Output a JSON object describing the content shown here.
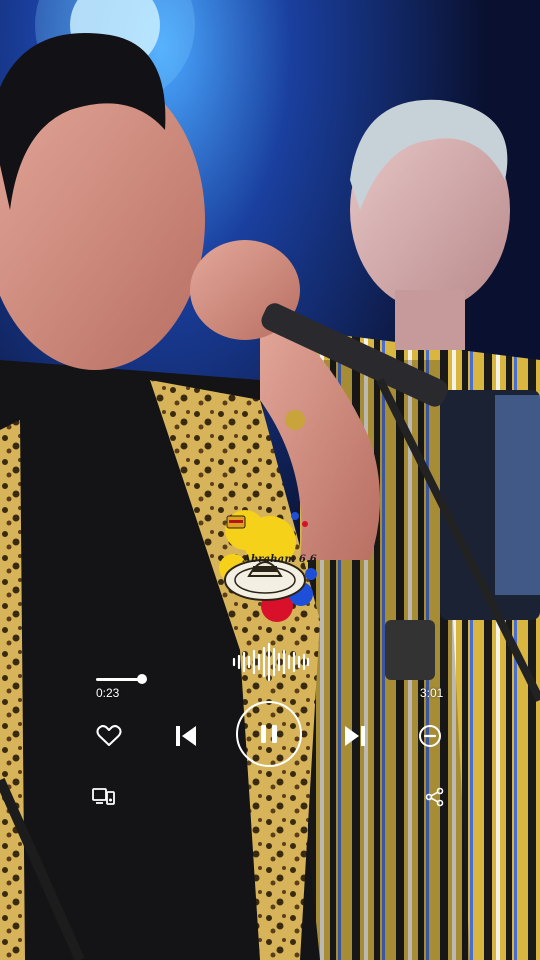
{
  "player": {
    "elapsed": "0:23",
    "duration": "3:01",
    "progress_fraction": 0.13,
    "state": "playing"
  },
  "logo": {
    "text": "Abraham 6.6"
  },
  "icons": {
    "like": "heart-icon",
    "previous": "skip-previous-icon",
    "pause": "pause-icon",
    "next": "skip-next-icon",
    "remove": "minus-circle-icon",
    "devices": "devices-icon",
    "share": "share-icon",
    "waveform": "waveform-icon"
  },
  "colors": {
    "controls": "#ffffff",
    "logo_yellow": "#f5d11a",
    "logo_red": "#d8102a",
    "logo_blue": "#1e4fd8"
  }
}
